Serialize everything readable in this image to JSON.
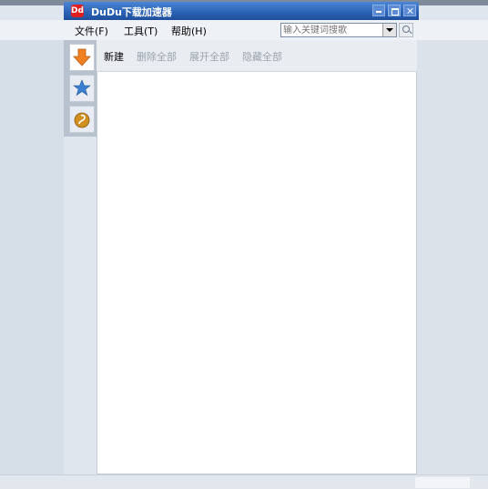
{
  "window": {
    "title": "DuDu下载加速器",
    "icon_text": "Dd"
  },
  "menu": {
    "file": "文件(F)",
    "tools": "工具(T)",
    "help": "帮助(H)"
  },
  "search": {
    "placeholder": "输入关键词搜歌",
    "value": ""
  },
  "sidebar": {
    "items": [
      "download-arrow-icon",
      "star-icon",
      "music-icon"
    ]
  },
  "toolbar": {
    "new": "新建",
    "delete_all": "删除全部",
    "expand_all": "展开全部",
    "hide_all": "隐藏全部"
  },
  "colors": {
    "title_bar": "#2c63b6",
    "accent_orange": "#f08020",
    "star_blue": "#3a7fd0",
    "disabled_text": "#9aa2ac"
  }
}
